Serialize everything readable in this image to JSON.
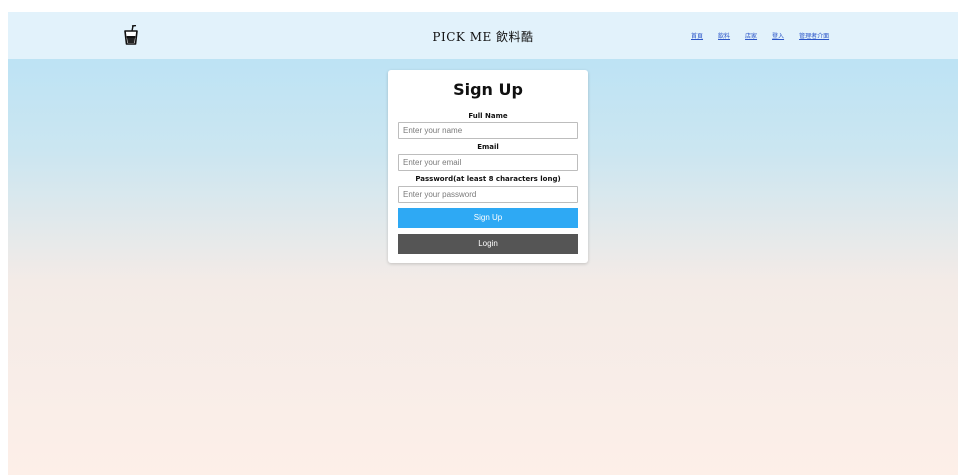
{
  "header": {
    "brand": "PICK ME 飲料酷",
    "logo_icon": "drink-cup-icon",
    "nav": [
      {
        "label": "首頁"
      },
      {
        "label": "飲料"
      },
      {
        "label": "店家"
      },
      {
        "label": "登入"
      },
      {
        "label": "管理者介面"
      }
    ]
  },
  "form": {
    "title": "Sign Up",
    "name_label": "Full Name",
    "name_placeholder": "Enter your name",
    "email_label": "Email",
    "email_placeholder": "Enter your email",
    "password_label": "Password(at least 8 characters long)",
    "password_placeholder": "Enter your password",
    "signup_button": "Sign Up",
    "login_button": "Login"
  },
  "colors": {
    "navbar": "#e2f2fb",
    "signup_button": "#2ea9f4",
    "login_button": "#555555",
    "link": "#2a55c8"
  }
}
